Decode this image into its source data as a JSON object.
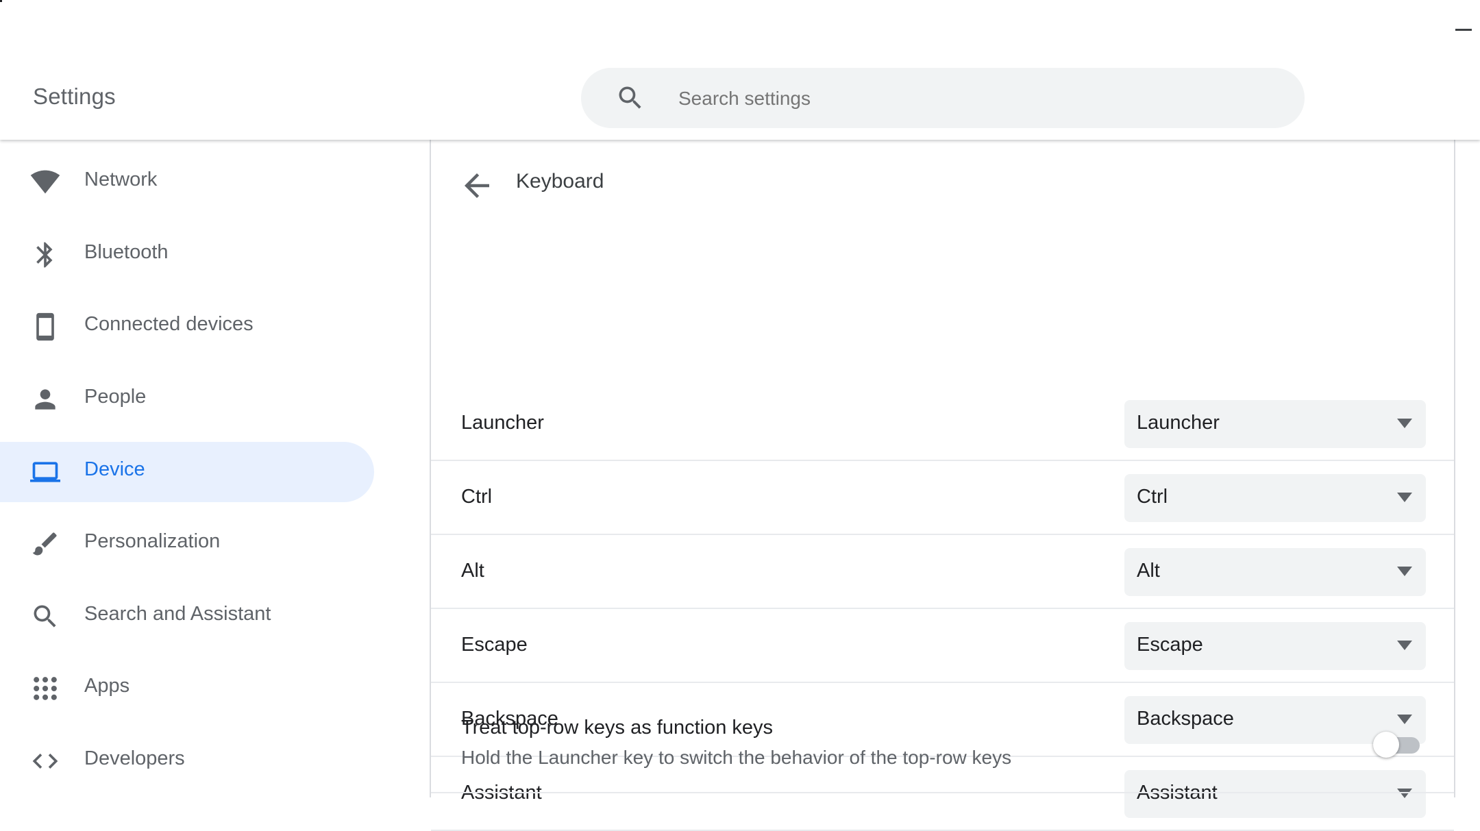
{
  "header": {
    "title": "Settings",
    "search": {
      "placeholder": "Search settings",
      "value": ""
    }
  },
  "sidebar": {
    "items": [
      {
        "label": "Network",
        "icon": "wifi-icon",
        "selected": false
      },
      {
        "label": "Bluetooth",
        "icon": "bluetooth-icon",
        "selected": false
      },
      {
        "label": "Connected devices",
        "icon": "phone-icon",
        "selected": false
      },
      {
        "label": "People",
        "icon": "person-icon",
        "selected": false
      },
      {
        "label": "Device",
        "icon": "laptop-icon",
        "selected": true
      },
      {
        "label": "Personalization",
        "icon": "brush-icon",
        "selected": false
      },
      {
        "label": "Search and Assistant",
        "icon": "search-icon",
        "selected": false
      },
      {
        "label": "Apps",
        "icon": "apps-grid-icon",
        "selected": false
      },
      {
        "label": "Developers",
        "icon": "code-icon",
        "selected": false
      }
    ]
  },
  "main": {
    "title": "Keyboard",
    "rows": [
      {
        "label": "Launcher",
        "value": "Launcher"
      },
      {
        "label": "Ctrl",
        "value": "Ctrl"
      },
      {
        "label": "Alt",
        "value": "Alt"
      },
      {
        "label": "Escape",
        "value": "Escape"
      },
      {
        "label": "Backspace",
        "value": "Backspace"
      },
      {
        "label": "Assistant",
        "value": "Assistant"
      }
    ],
    "toggle": {
      "title": "Treat top-row keys as function keys",
      "description": "Hold the Launcher key to switch the behavior of the top-row keys",
      "on": false
    }
  },
  "colors": {
    "accent": "#1a73e8",
    "selected_bg": "#e8f0fe",
    "search_bg": "#f1f3f4",
    "icon_gray": "#5f6368"
  }
}
